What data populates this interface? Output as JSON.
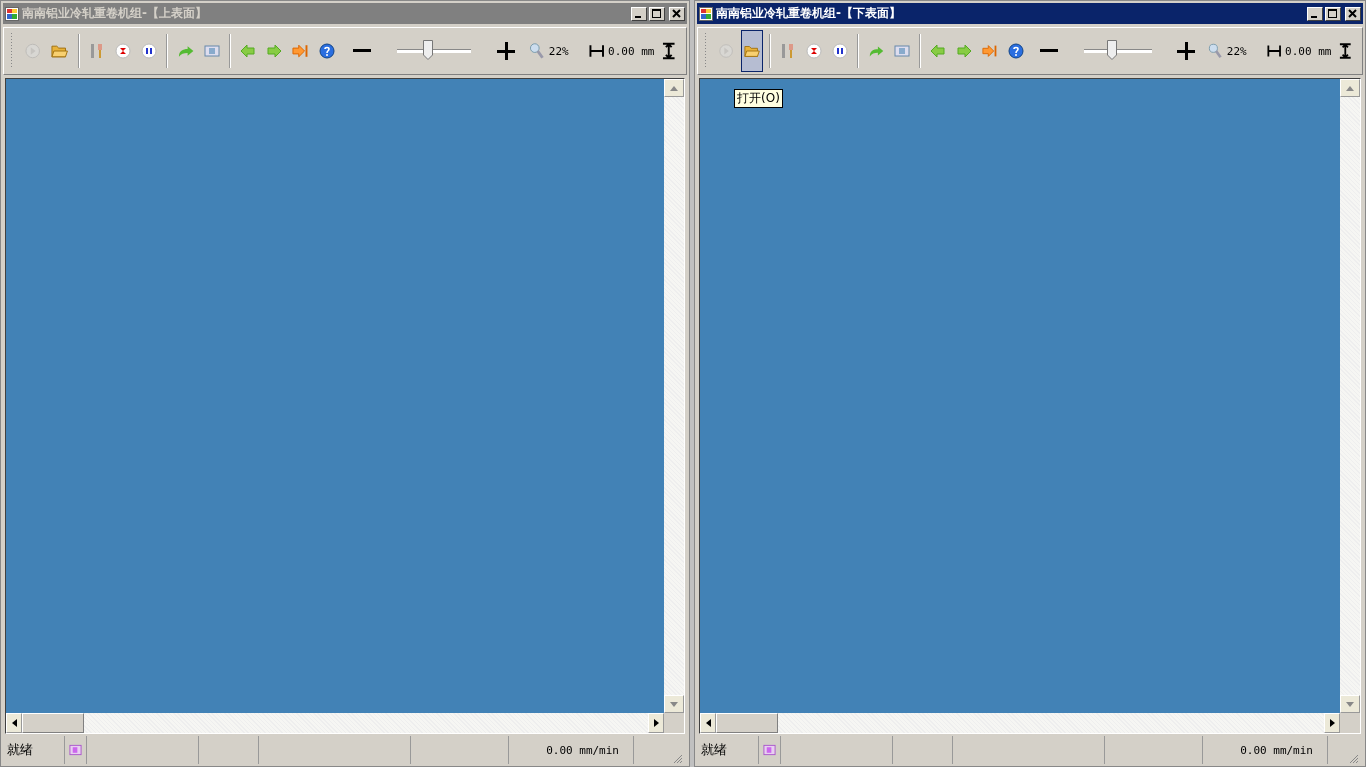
{
  "windows": [
    {
      "title": "南南铝业冷轧重卷机组-【上表面】",
      "active": false,
      "tools": [
        {
          "kind": "play",
          "disabled": true,
          "highlighted": false
        },
        {
          "kind": "open",
          "disabled": false,
          "highlighted": false
        },
        {
          "kind": "tools",
          "disabled": false,
          "highlighted": false
        },
        {
          "kind": "stop",
          "disabled": false,
          "highlighted": false
        },
        {
          "kind": "pause",
          "disabled": false,
          "highlighted": false
        },
        {
          "kind": "redo",
          "disabled": false,
          "highlighted": false
        },
        {
          "kind": "film",
          "disabled": false,
          "highlighted": false
        },
        {
          "kind": "left",
          "disabled": false,
          "highlighted": false
        },
        {
          "kind": "right",
          "disabled": false,
          "highlighted": false
        },
        {
          "kind": "end",
          "disabled": false,
          "highlighted": false
        },
        {
          "kind": "help",
          "disabled": false,
          "highlighted": false
        }
      ],
      "zoom": {
        "level": 0.42,
        "percent": "22%"
      },
      "width_reading": "0.00 mm",
      "status_bar": {
        "state": "就绪",
        "speed": "0.00 mm/min"
      }
    },
    {
      "title": "南南铝业冷轧重卷机组-【下表面】",
      "active": true,
      "tools": [
        {
          "kind": "play",
          "disabled": true,
          "highlighted": false
        },
        {
          "kind": "open",
          "disabled": false,
          "highlighted": true
        },
        {
          "kind": "tools",
          "disabled": false,
          "highlighted": false
        },
        {
          "kind": "stop",
          "disabled": false,
          "highlighted": false
        },
        {
          "kind": "pause",
          "disabled": false,
          "highlighted": false
        },
        {
          "kind": "redo",
          "disabled": false,
          "highlighted": false
        },
        {
          "kind": "film",
          "disabled": false,
          "highlighted": false
        },
        {
          "kind": "left",
          "disabled": false,
          "highlighted": false
        },
        {
          "kind": "right",
          "disabled": false,
          "highlighted": false
        },
        {
          "kind": "end",
          "disabled": false,
          "highlighted": false
        },
        {
          "kind": "help",
          "disabled": false,
          "highlighted": false
        }
      ],
      "zoom": {
        "level": 0.42,
        "percent": "22%"
      },
      "width_reading": "0.00 mm",
      "tooltip": "打开(O)",
      "status_bar": {
        "state": "就绪",
        "speed": "0.00 mm/min"
      }
    }
  ]
}
